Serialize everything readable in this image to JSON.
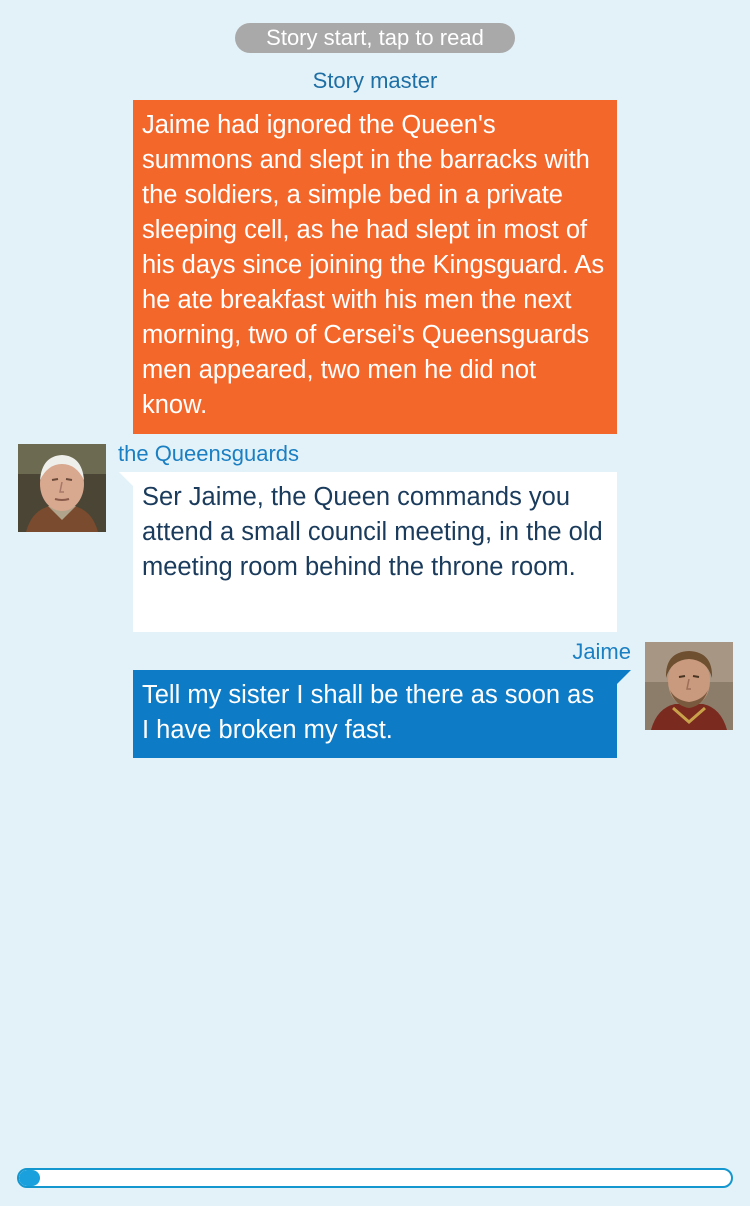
{
  "header": {
    "start_label": "Story start, tap to read"
  },
  "messages": [
    {
      "sender": "Story master",
      "kind": "narration",
      "text": "Jaime had ignored the Queen's summons and slept in the barracks with the soldiers, a simple bed in a private sleeping cell, as he had slept in most of his days since joining the Kingsguard. As he ate breakfast with his men the next morning, two of Cersei's Queensguards men appeared, two men he did not know."
    },
    {
      "sender": "the Queensguards",
      "kind": "incoming",
      "text": "Ser Jaime, the Queen commands you attend a small council meeting, in the old meeting room behind the throne room."
    },
    {
      "sender": "Jaime",
      "kind": "outgoing",
      "text": "Tell my sister I shall be there as soon as I have broken my fast."
    }
  ],
  "progress": {
    "fraction": 0.03
  },
  "colors": {
    "background": "#e3f2f8",
    "narration": "#f4672b",
    "incoming": "#ffffff",
    "outgoing": "#0d7bc5",
    "sender_name": "#1b7fc3",
    "pill": "#a9a9a9",
    "progress": "#1aa0dc"
  }
}
